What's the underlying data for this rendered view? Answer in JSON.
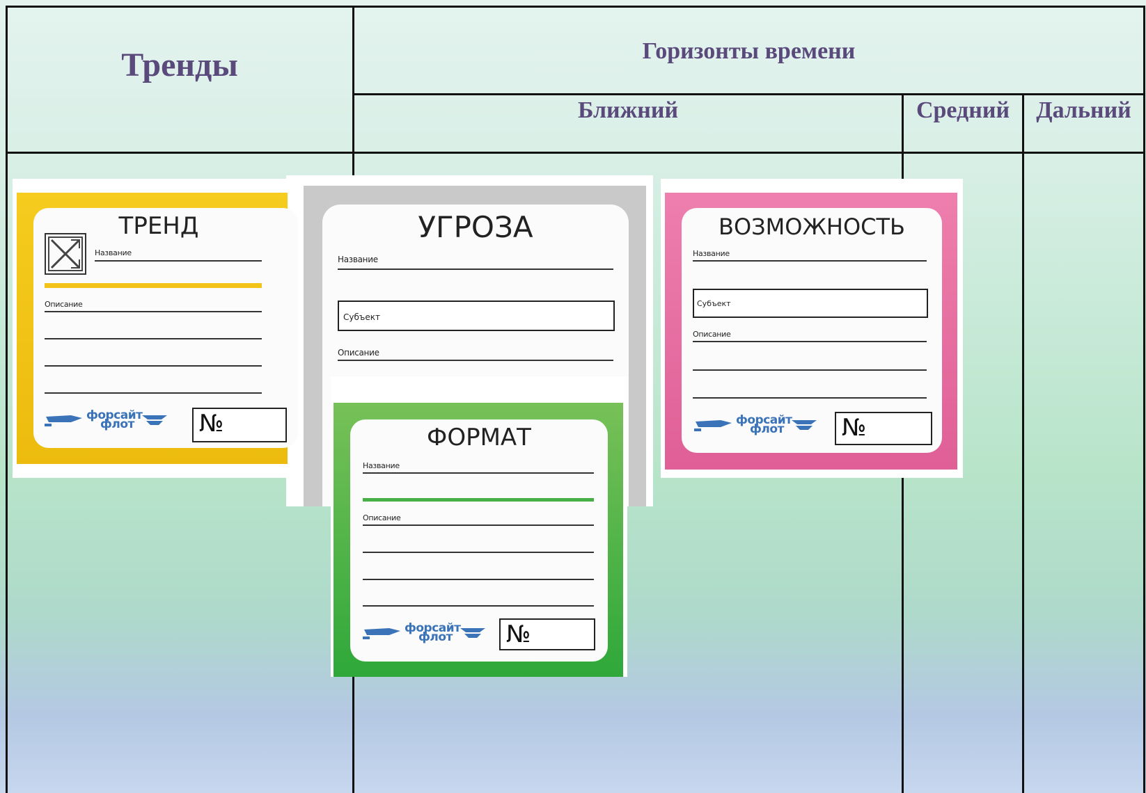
{
  "table": {
    "col_trends": "Тренды",
    "col_time_horizons": "Горизонты времени",
    "col_near": "Ближний",
    "col_mid": "Средний",
    "col_far": "Дальний"
  },
  "cards": {
    "trend": {
      "title": "ТРЕНД",
      "name_label": "Название",
      "desc_label": "Описание",
      "number_label": "№",
      "logo_line1": "форсайт",
      "logo_line2": "флот",
      "color": "#f2c419"
    },
    "threat": {
      "title": "УГРОЗА",
      "name_label": "Название",
      "subject_label": "Субъект",
      "desc_label": "Описание",
      "color": "#c9c9c9"
    },
    "opportunity": {
      "title": "ВОЗМОЖНОСТЬ",
      "name_label": "Название",
      "subject_label": "Субъект",
      "desc_label": "Описание",
      "number_label": "№",
      "logo_line1": "форсайт",
      "logo_line2": "флот",
      "color": "#e46ea0"
    },
    "format": {
      "title": "ФОРМАТ",
      "name_label": "Название",
      "desc_label": "Описание",
      "number_label": "№",
      "logo_line1": "форсайт",
      "logo_line2": "флот",
      "color": "#46b046"
    }
  }
}
